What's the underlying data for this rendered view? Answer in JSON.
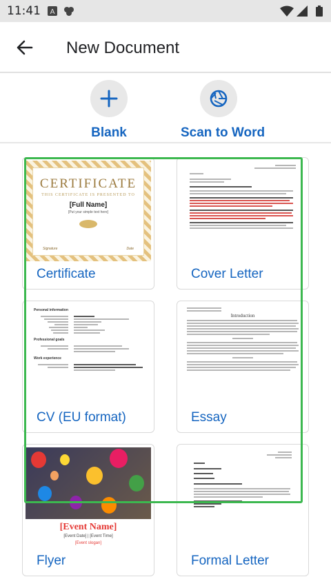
{
  "status": {
    "time": "11:41"
  },
  "header": {
    "title": "New Document"
  },
  "actions": [
    {
      "label": "Blank",
      "icon": "plus-icon"
    },
    {
      "label": "Scan to Word",
      "icon": "aperture-icon"
    }
  ],
  "templates": [
    {
      "label": "Certificate"
    },
    {
      "label": "Cover Letter"
    },
    {
      "label": "CV (EU format)"
    },
    {
      "label": "Essay"
    },
    {
      "label": "Flyer"
    },
    {
      "label": "Formal Letter"
    }
  ],
  "thumbs": {
    "certificate": {
      "title": "CERTIFICATE",
      "subtitle": "THIS CERTIFICATE IS PRESENTED TO",
      "name": "[Full Name]",
      "text": "[Put your simple text here]",
      "signature": "Signature",
      "date": "Date"
    },
    "cv": {
      "section1": "Personal information",
      "section2": "Professional goals",
      "section3": "Work experience"
    },
    "essay": {
      "heading": "Introduction"
    },
    "flyer": {
      "event": "[Event Name]",
      "date": "[Event Date] | [Event Time]",
      "slogan": "[Event slogan]"
    }
  },
  "colors": {
    "accent": "#1565c0",
    "highlight": "#3cb84f"
  }
}
